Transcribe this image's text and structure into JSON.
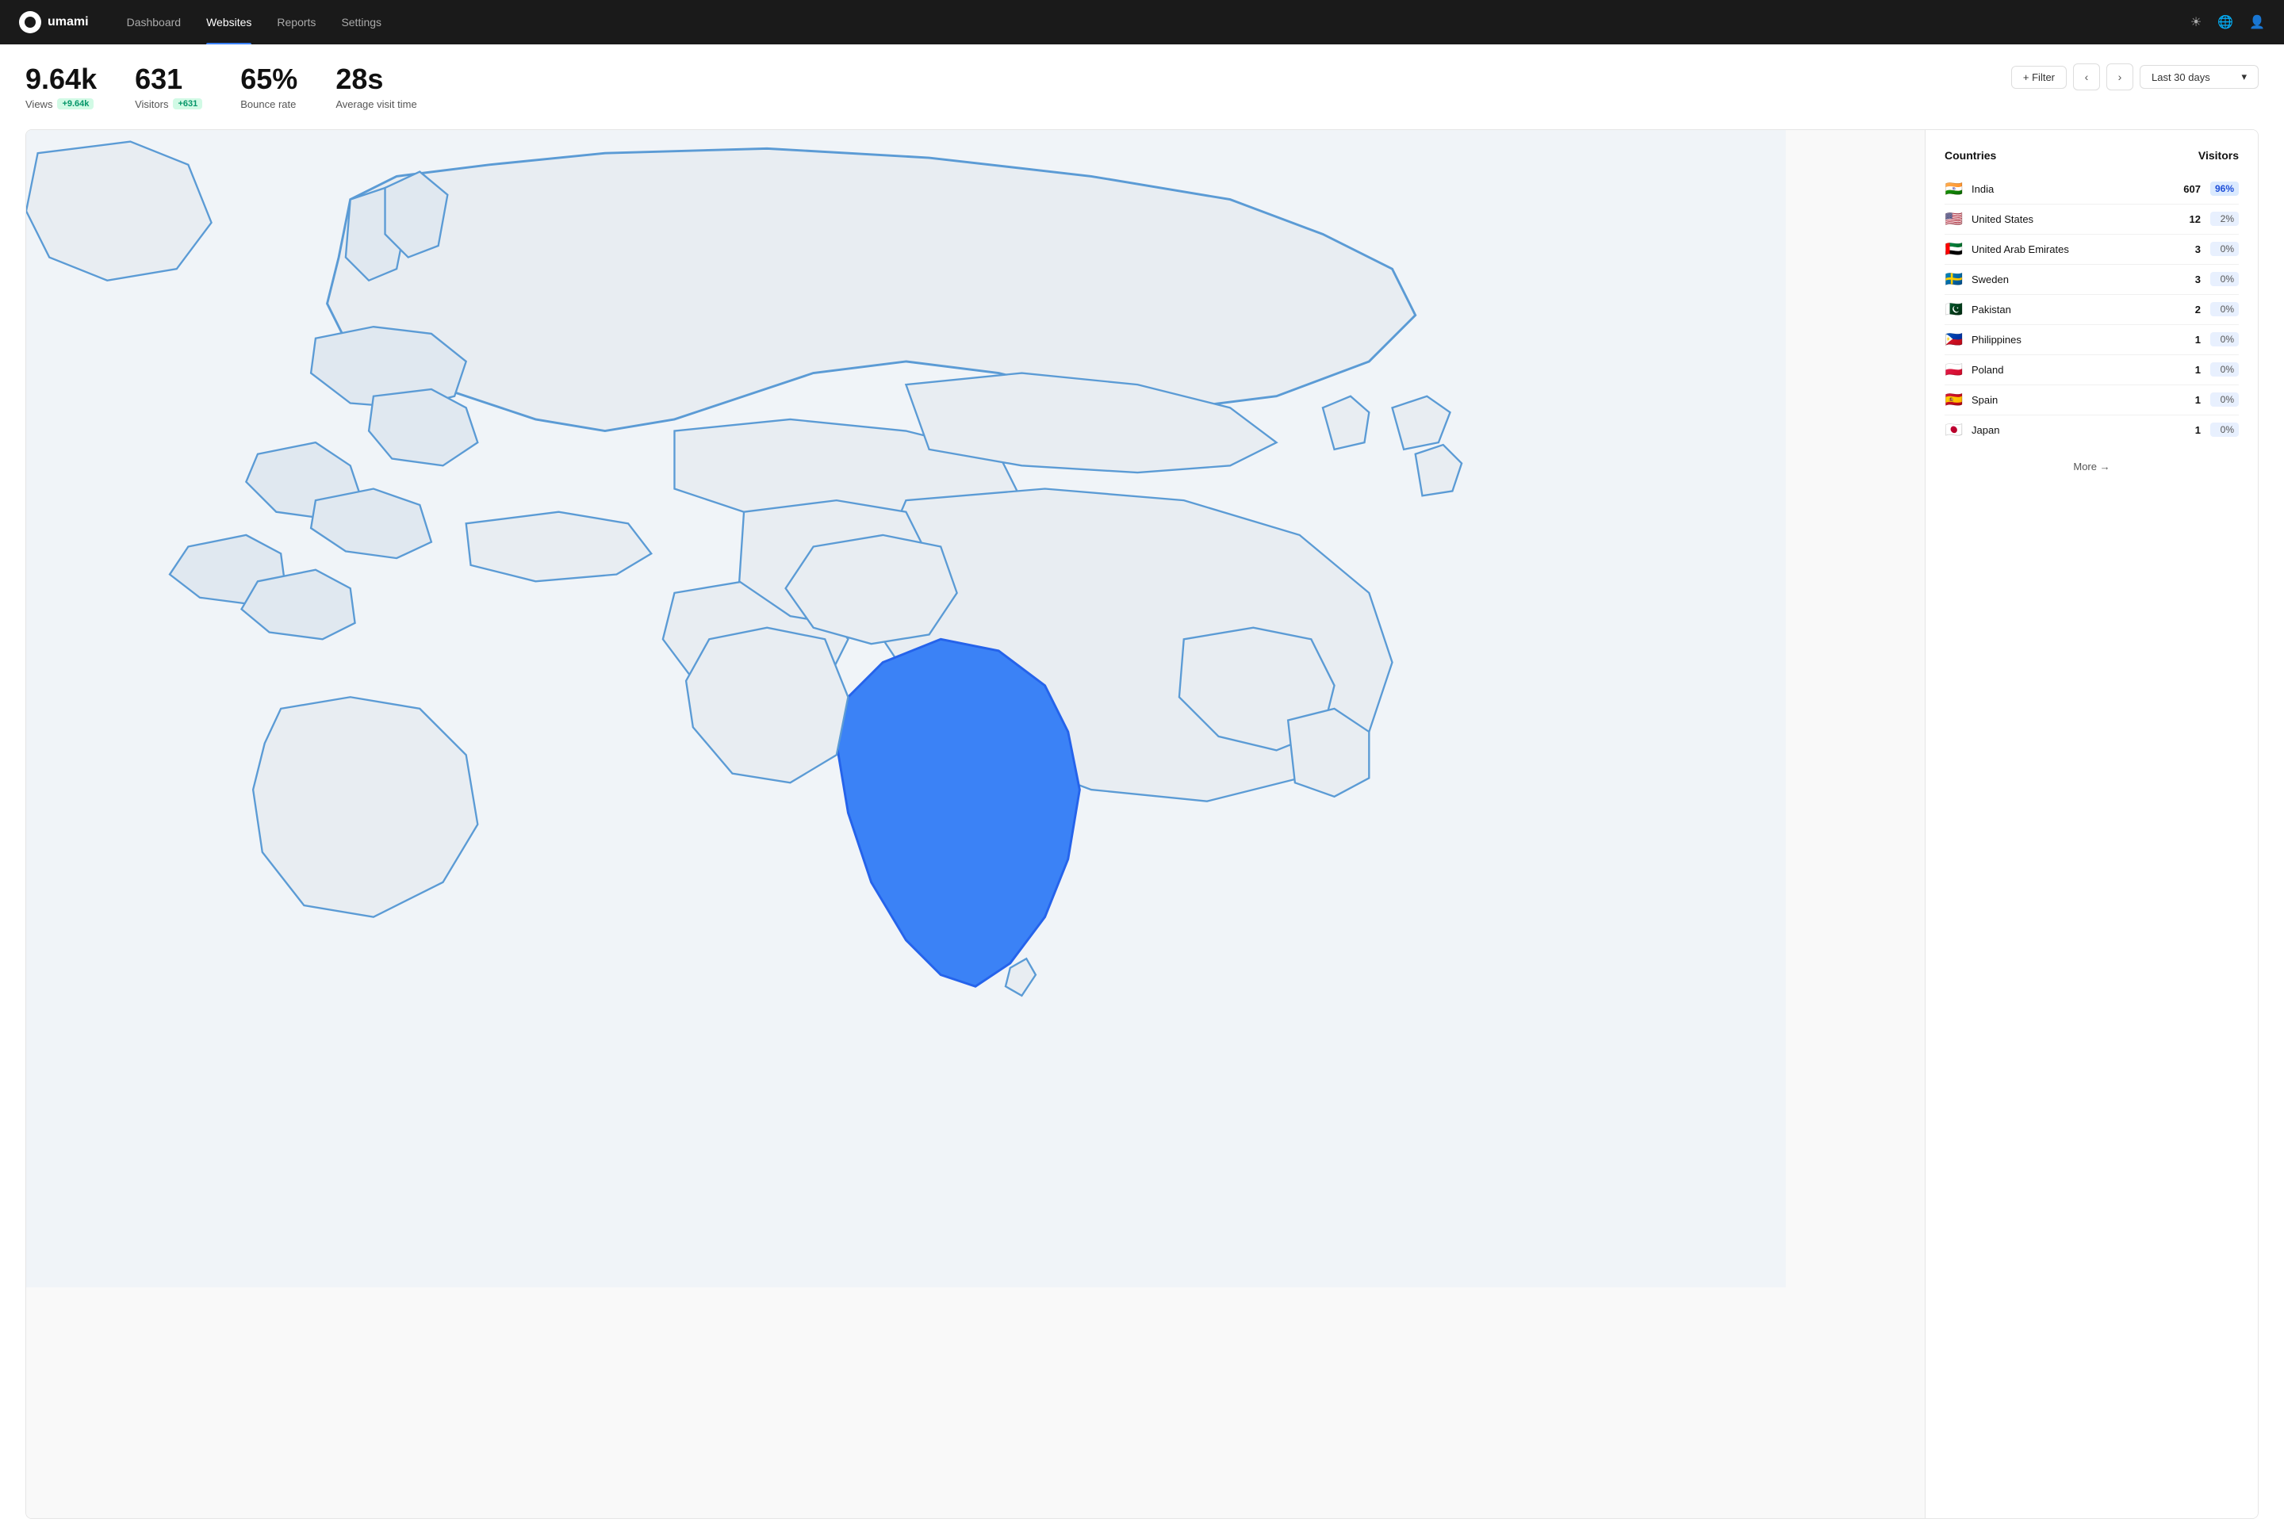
{
  "navbar": {
    "logo_text": "umami",
    "links": [
      {
        "id": "dashboard",
        "label": "Dashboard",
        "active": false
      },
      {
        "id": "websites",
        "label": "Websites",
        "active": true
      },
      {
        "id": "reports",
        "label": "Reports",
        "active": false
      },
      {
        "id": "settings",
        "label": "Settings",
        "active": false
      }
    ]
  },
  "stats": [
    {
      "id": "views",
      "value": "9.64k",
      "label": "Views",
      "badge": "+9.64k"
    },
    {
      "id": "visitors",
      "value": "631",
      "label": "Visitors",
      "badge": "+631"
    },
    {
      "id": "bounce",
      "value": "65%",
      "label": "Bounce rate",
      "badge": null
    },
    {
      "id": "visit_time",
      "value": "28s",
      "label": "Average visit time",
      "badge": null
    }
  ],
  "toolbar": {
    "filter_label": "+ Filter",
    "date_range": "Last 30 days"
  },
  "countries_header": "Countries",
  "visitors_header": "Visitors",
  "countries": [
    {
      "flag": "🇮🇳",
      "name": "India",
      "count": "607",
      "pct": "96%",
      "highlight": true
    },
    {
      "flag": "🇺🇸",
      "name": "United States",
      "count": "12",
      "pct": "2%",
      "highlight": false
    },
    {
      "flag": "🇦🇪",
      "name": "United Arab Emirates",
      "count": "3",
      "pct": "0%",
      "highlight": false
    },
    {
      "flag": "🇸🇪",
      "name": "Sweden",
      "count": "3",
      "pct": "0%",
      "highlight": false
    },
    {
      "flag": "🇵🇰",
      "name": "Pakistan",
      "count": "2",
      "pct": "0%",
      "highlight": false
    },
    {
      "flag": "🇵🇭",
      "name": "Philippines",
      "count": "1",
      "pct": "0%",
      "highlight": false
    },
    {
      "flag": "🇵🇱",
      "name": "Poland",
      "count": "1",
      "pct": "0%",
      "highlight": false
    },
    {
      "flag": "🇪🇸",
      "name": "Spain",
      "count": "1",
      "pct": "0%",
      "highlight": false
    },
    {
      "flag": "🇯🇵",
      "name": "Japan",
      "count": "1",
      "pct": "0%",
      "highlight": false
    }
  ],
  "more_label": "More →"
}
